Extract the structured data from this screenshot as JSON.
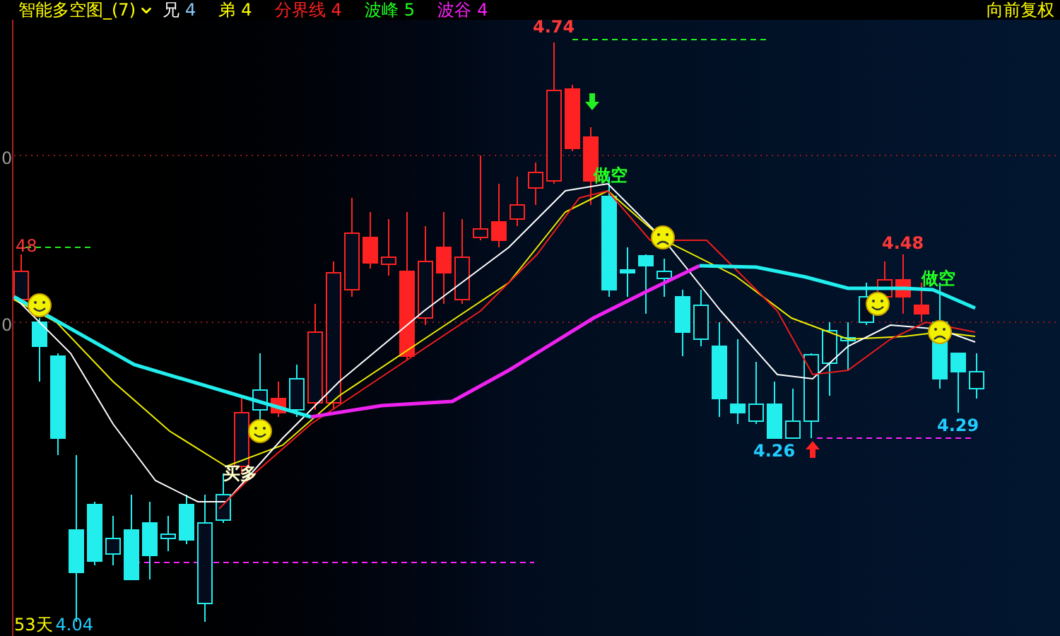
{
  "header": {
    "indicator": "智能多空图_(7)",
    "params": [
      {
        "name": {
          "text": "兄",
          "color": "#ffffff"
        },
        "value": {
          "text": "4",
          "color": "#88ccff"
        }
      },
      {
        "name": {
          "text": "弟",
          "color": "#ffff00"
        },
        "value": {
          "text": "4",
          "color": "#ffff00"
        }
      },
      {
        "name": {
          "text": "分界线",
          "color": "#ff2020"
        },
        "value": {
          "text": "4",
          "color": "#ff2020"
        }
      },
      {
        "name": {
          "text": "波峰",
          "color": "#20ff20"
        },
        "value": {
          "text": "5",
          "color": "#20ff20"
        }
      },
      {
        "name": {
          "text": "波谷",
          "color": "#ff20ff"
        },
        "value": {
          "text": "4",
          "color": "#ff20ff"
        }
      }
    ],
    "adjust": "向前复权"
  },
  "axis_labels": [
    "0",
    "0",
    "48"
  ],
  "chart_labels": [
    {
      "text": "4.74",
      "kind": "high"
    },
    {
      "text": "做空",
      "kind": "short"
    },
    {
      "text": "买多",
      "kind": "long"
    },
    {
      "text": "4.48",
      "kind": "high"
    },
    {
      "text": "做空",
      "kind": "short"
    },
    {
      "text": "4.26",
      "kind": "low"
    },
    {
      "text": "4.29",
      "kind": "low"
    }
  ],
  "footer": {
    "period": "53天",
    "price": "4.04"
  }
}
